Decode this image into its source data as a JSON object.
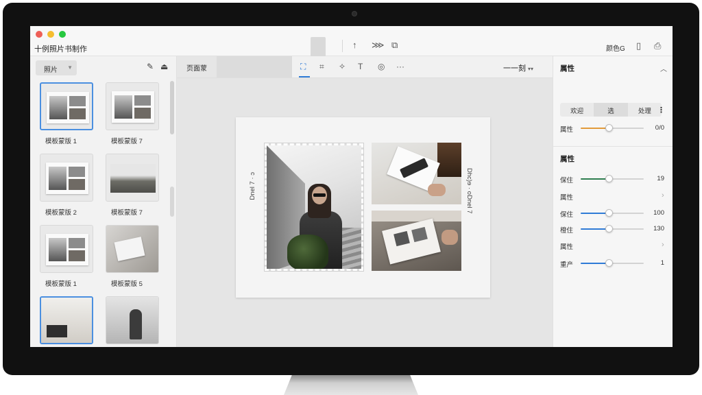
{
  "window": {
    "title": "十例照片书制作",
    "traffic_colors": [
      "#ee5f57",
      "#f5bd2f",
      "#27c840"
    ],
    "top_tool_icons": [
      "move-up-icon",
      "arrange-icon",
      "layers-icon"
    ],
    "top_right_text": "颜色G",
    "top_right_icons": [
      "phone-icon",
      "export-icon"
    ]
  },
  "sidebar": {
    "dropdown_label": "照片",
    "icons": [
      "pen-icon",
      "collapse-icon"
    ],
    "thumbnails": [
      {
        "label": "模板蒙版 1",
        "kind": "collage",
        "selected": true
      },
      {
        "label": "模板蒙版 7",
        "kind": "collage",
        "selected": false
      },
      {
        "label": "模板蒙版 2",
        "kind": "collage",
        "selected": false
      },
      {
        "label": "模板蒙版 7",
        "kind": "landscape",
        "selected": false
      },
      {
        "label": "模板蒙版 1",
        "kind": "collage",
        "selected": false
      },
      {
        "label": "模板蒙版 5",
        "kind": "desk",
        "selected": false
      },
      {
        "label": "",
        "kind": "room",
        "selected": true
      },
      {
        "label": "",
        "kind": "walk",
        "selected": false
      }
    ]
  },
  "toolbar": {
    "tab_label": "页面蒙",
    "tools": [
      "select-icon",
      "crop-icon",
      "shape-icon",
      "text-icon",
      "frame-icon",
      "more-icon"
    ],
    "tool_glyphs": [
      "⛶",
      "⌗",
      "✧",
      "T",
      "◎",
      "···"
    ],
    "zoom_label": "一一刻"
  },
  "spread": {
    "left_caption": "Dnel 7 · ɔ",
    "right_caption": "Dhc)ɘ · oDnel 7",
    "photos": [
      "portrait-photo",
      "desk-device-photo",
      "photo-book-photo"
    ]
  },
  "panel": {
    "section1_title": "属性",
    "segments": [
      "欢迎",
      "选",
      "处理"
    ],
    "segment_active": 1,
    "row1": {
      "label": "属性",
      "value": "0/0",
      "fraction": 0.45,
      "color": "#e29a3a"
    },
    "section2_title": "属性",
    "rows": [
      {
        "label": "保住",
        "value": "19",
        "fraction": 0.45,
        "color": "#2e7d4f",
        "type": "slider"
      },
      {
        "label": "属性",
        "type": "link"
      },
      {
        "label": "保住",
        "value": "100",
        "fraction": 0.45,
        "color": "#2f7bd6",
        "type": "slider"
      },
      {
        "label": "橙住",
        "value": "130",
        "fraction": 0.45,
        "color": "#2f7bd6",
        "type": "slider"
      },
      {
        "label": "属性",
        "type": "link"
      },
      {
        "label": "重产",
        "value": "1",
        "fraction": 0.45,
        "color": "#2f7bd6",
        "type": "slider"
      }
    ]
  }
}
